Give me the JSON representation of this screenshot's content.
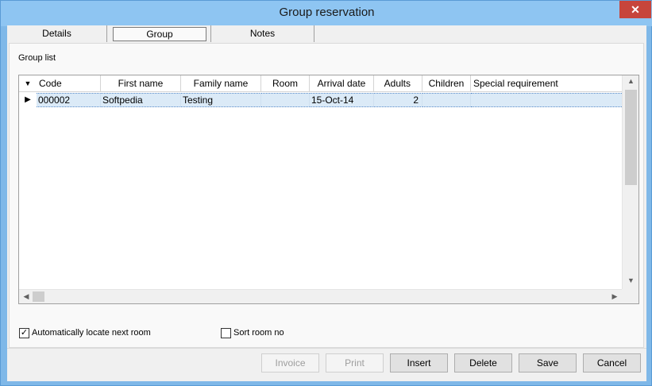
{
  "window": {
    "title": "Group reservation",
    "close_glyph": "✕"
  },
  "tabs": [
    {
      "label": "Details"
    },
    {
      "label": "Group"
    },
    {
      "label": "Notes"
    }
  ],
  "group_list": {
    "label": "Group list",
    "sort_glyph": "▼",
    "columns": [
      "Code",
      "First name",
      "Family name",
      "Room",
      "Arrival date",
      "Adults",
      "Children",
      "Special requirement"
    ],
    "rows": [
      {
        "marker": "▶",
        "code": "000002",
        "first_name": "Softpedia",
        "family_name": "Testing",
        "room": "",
        "arrival_date": "15-Oct-14",
        "adults": "2",
        "children": "",
        "special_requirement": ""
      }
    ],
    "scroll_glyphs": {
      "up": "▲",
      "down": "▼",
      "left": "◀",
      "right": "▶"
    }
  },
  "options": {
    "auto_locate": {
      "label": "Automatically locate next room",
      "checked": true,
      "glyph": "✓"
    },
    "sort_room": {
      "label": "Sort room no",
      "checked": false
    }
  },
  "buttons": {
    "invoice": "Invoice",
    "print": "Print",
    "insert": "Insert",
    "delete": "Delete",
    "save": "Save",
    "cancel": "Cancel"
  },
  "colors": {
    "title_bar": "#8ec5f2",
    "selected_row": "#dbeaf7",
    "close_button": "#c7453b"
  }
}
